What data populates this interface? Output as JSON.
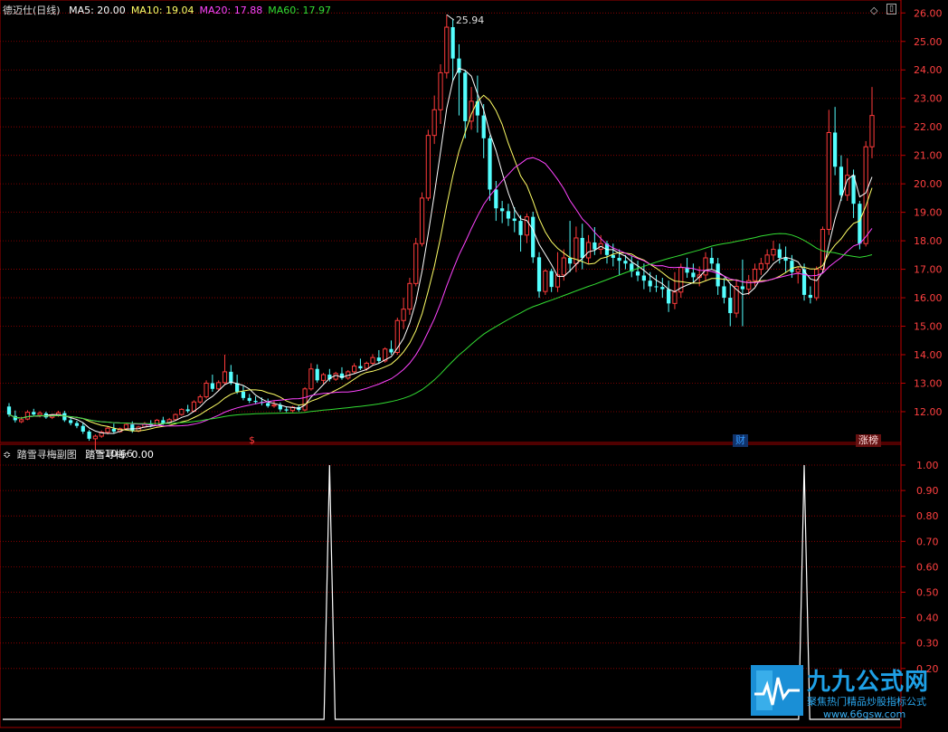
{
  "main_panel": {
    "title": "德迈仕(日线)",
    "ma_labels": [
      {
        "text": "MA5: 20.00",
        "color": "#ffffff"
      },
      {
        "text": "MA10: 19.04",
        "color": "#ffff66"
      },
      {
        "text": "MA20: 17.88",
        "color": "#ff44ff"
      },
      {
        "text": "MA60: 17.97",
        "color": "#33dd33"
      }
    ],
    "markers": [
      {
        "label": "$",
        "color": "#ff3b3b"
      },
      {
        "label": "财",
        "color": "#3399ff"
      },
      {
        "label": "涨榜",
        "color": "#ffdddd"
      }
    ],
    "high_label": "25.94",
    "low_label": "10.66"
  },
  "sub_panel": {
    "title": "踏雪寻梅副图",
    "value_label": "踏雪寻梅: 0.00"
  },
  "colors": {
    "up": "#ff3b3b",
    "down": "#54ffff",
    "grid": "#a00000",
    "ma5": "#ffffff",
    "ma10": "#ffff66",
    "ma20": "#ff44ff",
    "ma60": "#33dd33",
    "axis_text": "#ff4040"
  },
  "logo": {
    "name": "九九公式网",
    "slogan": "聚焦热门精品炒股指标公式",
    "url": "www.66gsw.com"
  },
  "chart_data": {
    "type": "candlestick",
    "main": {
      "y_ticks": [
        26,
        25,
        24,
        23,
        22,
        21,
        20,
        19,
        18,
        17,
        16,
        15,
        14,
        13,
        12
      ],
      "ylim": [
        11.3,
        26.2
      ],
      "high": 25.94,
      "low": 10.66
    },
    "sub": {
      "y_ticks": [
        1.0,
        0.9,
        0.8,
        0.7,
        0.6,
        0.5,
        0.4,
        0.3,
        0.2
      ],
      "ylim": [
        0,
        1.0
      ],
      "series_name": "踏雪寻梅",
      "spikes": [
        1.0,
        1.0
      ]
    },
    "candles": [
      [
        12.18,
        12.3,
        11.9,
        11.82
      ],
      [
        11.85,
        12.04,
        11.7,
        11.62
      ],
      [
        11.65,
        11.82,
        11.72,
        11.6
      ],
      [
        11.74,
        12.05,
        11.98,
        11.7
      ],
      [
        11.99,
        12.1,
        11.9,
        11.84
      ],
      [
        11.88,
        12.02,
        11.95,
        11.8
      ],
      [
        11.94,
        12.0,
        11.8,
        11.75
      ],
      [
        11.8,
        11.92,
        11.87,
        11.74
      ],
      [
        11.86,
        12.03,
        11.96,
        11.82
      ],
      [
        11.95,
        12.03,
        11.7,
        11.64
      ],
      [
        11.7,
        11.8,
        11.6,
        11.52
      ],
      [
        11.6,
        11.68,
        11.5,
        11.42
      ],
      [
        11.5,
        11.62,
        11.3,
        11.22
      ],
      [
        11.3,
        11.36,
        11.05,
        10.98
      ],
      [
        11.05,
        11.2,
        11.14,
        10.66
      ],
      [
        11.14,
        11.34,
        11.28,
        11.08
      ],
      [
        11.28,
        11.5,
        11.42,
        11.2
      ],
      [
        11.4,
        11.58,
        11.3,
        11.22
      ],
      [
        11.3,
        11.44,
        11.4,
        11.26
      ],
      [
        11.4,
        11.58,
        11.55,
        11.35
      ],
      [
        11.55,
        11.66,
        11.32,
        11.26
      ],
      [
        11.32,
        11.5,
        11.46,
        11.28
      ],
      [
        11.46,
        11.64,
        11.58,
        11.42
      ],
      [
        11.58,
        11.7,
        11.52,
        11.45
      ],
      [
        11.52,
        11.74,
        11.7,
        11.48
      ],
      [
        11.7,
        11.82,
        11.6,
        11.54
      ],
      [
        11.6,
        11.78,
        11.72,
        11.56
      ],
      [
        11.72,
        11.94,
        11.9,
        11.68
      ],
      [
        11.9,
        12.12,
        12.08,
        11.86
      ],
      [
        12.08,
        12.24,
        12.02,
        11.96
      ],
      [
        12.02,
        12.4,
        12.34,
        11.98
      ],
      [
        12.34,
        12.6,
        12.52,
        12.28
      ],
      [
        12.52,
        13.1,
        13.0,
        12.46
      ],
      [
        13.0,
        13.3,
        12.8,
        12.7
      ],
      [
        12.8,
        13.1,
        13.02,
        12.72
      ],
      [
        13.02,
        14.0,
        13.4,
        12.96
      ],
      [
        13.4,
        13.64,
        13.0,
        12.94
      ],
      [
        13.0,
        13.3,
        12.7,
        12.62
      ],
      [
        12.7,
        12.9,
        12.48,
        12.4
      ],
      [
        12.48,
        12.62,
        12.38,
        12.3
      ],
      [
        12.38,
        12.54,
        12.34,
        12.26
      ],
      [
        12.34,
        12.5,
        12.3,
        12.22
      ],
      [
        12.3,
        12.46,
        12.2,
        12.14
      ],
      [
        12.2,
        12.38,
        12.24,
        12.14
      ],
      [
        12.24,
        12.32,
        12.08,
        12.0
      ],
      [
        12.08,
        12.18,
        12.04,
        11.98
      ],
      [
        12.04,
        12.2,
        12.16,
        11.98
      ],
      [
        12.16,
        12.24,
        12.06,
        12.0
      ],
      [
        12.06,
        12.86,
        12.8,
        12.02
      ],
      [
        12.8,
        13.7,
        13.5,
        12.74
      ],
      [
        13.5,
        13.66,
        13.1,
        13.02
      ],
      [
        13.1,
        13.36,
        13.3,
        12.98
      ],
      [
        13.3,
        13.5,
        13.14,
        13.06
      ],
      [
        13.14,
        13.4,
        13.34,
        13.08
      ],
      [
        13.34,
        13.56,
        13.18,
        13.12
      ],
      [
        13.18,
        13.46,
        13.4,
        13.12
      ],
      [
        13.4,
        13.7,
        13.6,
        13.34
      ],
      [
        13.6,
        13.86,
        13.52,
        13.46
      ],
      [
        13.52,
        13.76,
        13.7,
        13.44
      ],
      [
        13.7,
        14.02,
        13.9,
        13.62
      ],
      [
        13.9,
        14.16,
        13.78,
        13.7
      ],
      [
        13.78,
        14.26,
        14.2,
        13.72
      ],
      [
        14.2,
        14.5,
        14.08,
        14.0
      ],
      [
        14.08,
        15.3,
        15.2,
        14.0
      ],
      [
        15.2,
        16.0,
        15.6,
        14.9
      ],
      [
        15.6,
        16.7,
        16.5,
        15.4
      ],
      [
        16.5,
        18.1,
        17.9,
        16.4
      ],
      [
        17.9,
        19.7,
        19.5,
        17.8
      ],
      [
        19.5,
        21.9,
        21.7,
        19.4
      ],
      [
        21.7,
        23.1,
        22.6,
        21.4
      ],
      [
        22.6,
        24.2,
        23.9,
        22.1
      ],
      [
        23.9,
        25.94,
        25.5,
        23.7
      ],
      [
        25.5,
        25.8,
        24.4,
        23.6
      ],
      [
        24.4,
        24.9,
        23.9,
        22.4
      ],
      [
        23.9,
        24.0,
        22.2,
        21.6
      ],
      [
        22.2,
        23.4,
        22.9,
        21.9
      ],
      [
        22.9,
        23.8,
        22.4,
        21.8
      ],
      [
        22.4,
        22.8,
        21.6,
        20.9
      ],
      [
        21.6,
        21.7,
        19.8,
        19.4
      ],
      [
        19.8,
        20.1,
        19.14,
        18.7
      ],
      [
        19.14,
        19.4,
        19.04,
        18.62
      ],
      [
        19.04,
        19.3,
        18.78,
        18.52
      ],
      [
        18.78,
        19.18,
        18.7,
        18.3
      ],
      [
        18.7,
        18.9,
        18.2,
        17.62
      ],
      [
        18.2,
        18.96,
        18.84,
        17.92
      ],
      [
        18.84,
        19.02,
        17.42,
        17.22
      ],
      [
        17.42,
        17.6,
        16.22,
        16.0
      ],
      [
        16.22,
        17.0,
        16.94,
        16.1
      ],
      [
        16.94,
        17.02,
        16.38,
        16.2
      ],
      [
        16.38,
        17.6,
        16.8,
        16.2
      ],
      [
        16.8,
        17.7,
        17.4,
        16.6
      ],
      [
        17.4,
        18.7,
        17.2,
        16.9
      ],
      [
        17.2,
        18.5,
        18.1,
        16.9
      ],
      [
        18.1,
        18.6,
        17.4,
        17.0
      ],
      [
        17.4,
        18.2,
        17.94,
        17.2
      ],
      [
        17.94,
        18.48,
        17.7,
        17.5
      ],
      [
        17.7,
        18.2,
        17.9,
        17.52
      ],
      [
        17.9,
        18.0,
        17.5,
        17.2
      ],
      [
        17.5,
        17.9,
        17.4,
        17.1
      ],
      [
        17.4,
        17.7,
        17.3,
        16.8
      ],
      [
        17.3,
        17.5,
        17.2,
        17.0
      ],
      [
        17.2,
        17.46,
        16.92,
        16.72
      ],
      [
        16.92,
        17.3,
        16.78,
        16.58
      ],
      [
        16.78,
        17.2,
        16.6,
        16.3
      ],
      [
        16.6,
        16.9,
        16.4,
        16.2
      ],
      [
        16.4,
        16.8,
        16.38,
        16.2
      ],
      [
        16.38,
        16.7,
        16.3,
        16.0
      ],
      [
        16.3,
        16.6,
        15.8,
        15.5
      ],
      [
        15.8,
        16.9,
        16.2,
        15.6
      ],
      [
        16.2,
        17.2,
        17.06,
        16.0
      ],
      [
        17.06,
        17.4,
        16.88,
        16.7
      ],
      [
        16.88,
        17.2,
        16.72,
        16.5
      ],
      [
        16.72,
        17.1,
        16.8,
        16.4
      ],
      [
        16.8,
        17.6,
        17.4,
        16.6
      ],
      [
        17.4,
        17.76,
        17.2,
        17.0
      ],
      [
        17.2,
        17.4,
        16.4,
        16.1
      ],
      [
        16.4,
        16.7,
        16.0,
        15.8
      ],
      [
        16.0,
        16.5,
        15.46,
        15.0
      ],
      [
        15.46,
        16.6,
        16.4,
        15.3
      ],
      [
        16.4,
        17.34,
        16.3,
        15.0
      ],
      [
        16.3,
        16.8,
        16.6,
        16.1
      ],
      [
        16.6,
        17.2,
        17.0,
        16.4
      ],
      [
        17.0,
        17.4,
        17.2,
        16.8
      ],
      [
        17.2,
        17.7,
        17.5,
        17.0
      ],
      [
        17.5,
        18.0,
        17.7,
        17.3
      ],
      [
        17.7,
        17.9,
        17.4,
        17.2
      ],
      [
        17.4,
        17.8,
        17.3,
        16.9
      ],
      [
        17.3,
        17.5,
        16.9,
        16.7
      ],
      [
        16.9,
        17.1,
        17.0,
        16.5
      ],
      [
        17.0,
        17.2,
        16.1,
        15.9
      ],
      [
        16.1,
        16.4,
        16.0,
        15.8
      ],
      [
        16.0,
        17.1,
        17.0,
        15.9
      ],
      [
        17.0,
        18.5,
        18.4,
        16.9
      ],
      [
        18.4,
        22.6,
        21.8,
        18.2
      ],
      [
        21.8,
        22.7,
        20.6,
        20.3
      ],
      [
        20.6,
        21.0,
        19.6,
        19.4
      ],
      [
        19.6,
        20.9,
        20.3,
        19.4
      ],
      [
        20.3,
        20.5,
        19.3,
        18.8
      ],
      [
        19.3,
        19.4,
        17.9,
        17.7
      ],
      [
        17.9,
        21.5,
        21.3,
        17.8
      ],
      [
        21.3,
        23.4,
        22.4,
        20.9
      ]
    ]
  }
}
